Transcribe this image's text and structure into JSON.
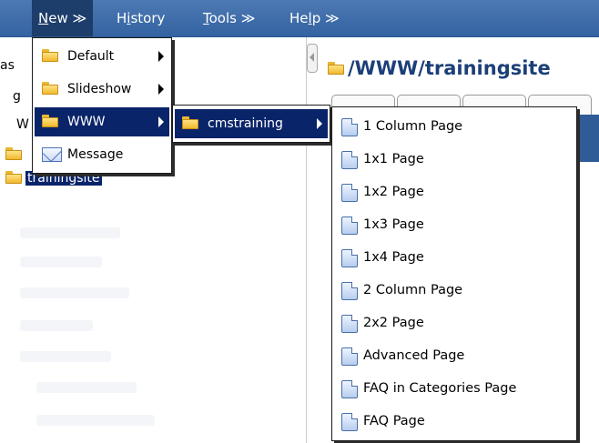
{
  "menubar": {
    "items": [
      {
        "label": "New ≫",
        "accel": "N",
        "rest": "ew ≫"
      },
      {
        "label": "History",
        "pre": "H",
        "accel": "i",
        "rest": "story"
      },
      {
        "label": "Tools ≫",
        "accel": "T",
        "rest": "ools ≫"
      },
      {
        "label": "Help ≫",
        "pre": "He",
        "accel": "l",
        "rest": "p ≫"
      }
    ]
  },
  "left_tree": {
    "partial_rows": [
      "as",
      "g",
      "W"
    ],
    "folders": [
      {
        "label": ""
      },
      {
        "label": "trainingsite",
        "selected": true
      }
    ]
  },
  "content": {
    "path": "/WWW/trainingsite"
  },
  "new_menu": {
    "items": [
      {
        "label": "Default",
        "icon": "folder-icon",
        "submenu": true
      },
      {
        "label": "Slideshow",
        "icon": "folder-icon",
        "submenu": true
      },
      {
        "label": "WWW",
        "icon": "folder-icon",
        "submenu": true,
        "highlighted": true
      },
      {
        "label": "Message",
        "icon": "mail-icon",
        "submenu": false
      }
    ]
  },
  "www_submenu": {
    "items": [
      {
        "label": "cmstraining",
        "icon": "folder-icon",
        "submenu": true,
        "highlighted": true
      }
    ]
  },
  "page_menu": {
    "items": [
      "1 Column Page",
      "1x1 Page",
      "1x2 Page",
      "1x3 Page",
      "1x4 Page",
      "2 Column Page",
      "2x2 Page",
      "Advanced Page",
      "FAQ in Categories Page",
      "FAQ Page"
    ]
  },
  "colors": {
    "menubar": "#3463a2",
    "highlight": "#0a246a",
    "title": "#1c3f78"
  }
}
